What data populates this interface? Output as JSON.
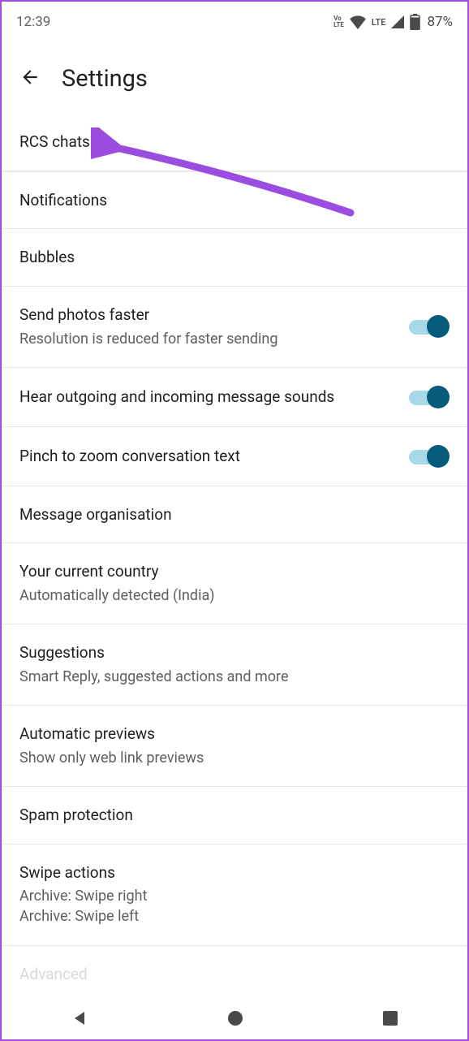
{
  "status": {
    "time": "12:39",
    "volte": "Vo\nLTE",
    "lte": "LTE",
    "battery": "87%"
  },
  "header": {
    "title": "Settings"
  },
  "items": {
    "rcs": {
      "title": "RCS chats"
    },
    "notif": {
      "title": "Notifications"
    },
    "bubbles": {
      "title": "Bubbles"
    },
    "photos": {
      "title": "Send photos faster",
      "subtitle": "Resolution is reduced for faster sending",
      "toggle": true
    },
    "sounds": {
      "title": "Hear outgoing and incoming message sounds",
      "toggle": true
    },
    "pinch": {
      "title": "Pinch to zoom conversation text",
      "toggle": true
    },
    "org": {
      "title": "Message organisation"
    },
    "country": {
      "title": "Your current country",
      "subtitle": "Automatically detected (India)"
    },
    "sugg": {
      "title": "Suggestions",
      "subtitle": "Smart Reply, suggested actions and more"
    },
    "previews": {
      "title": "Automatic previews",
      "subtitle": "Show only web link previews"
    },
    "spam": {
      "title": "Spam protection"
    },
    "swipe": {
      "title": "Swipe actions",
      "subtitle1": "Archive: Swipe right",
      "subtitle2": "Archive: Swipe left"
    },
    "advanced": {
      "title": "Advanced"
    }
  }
}
